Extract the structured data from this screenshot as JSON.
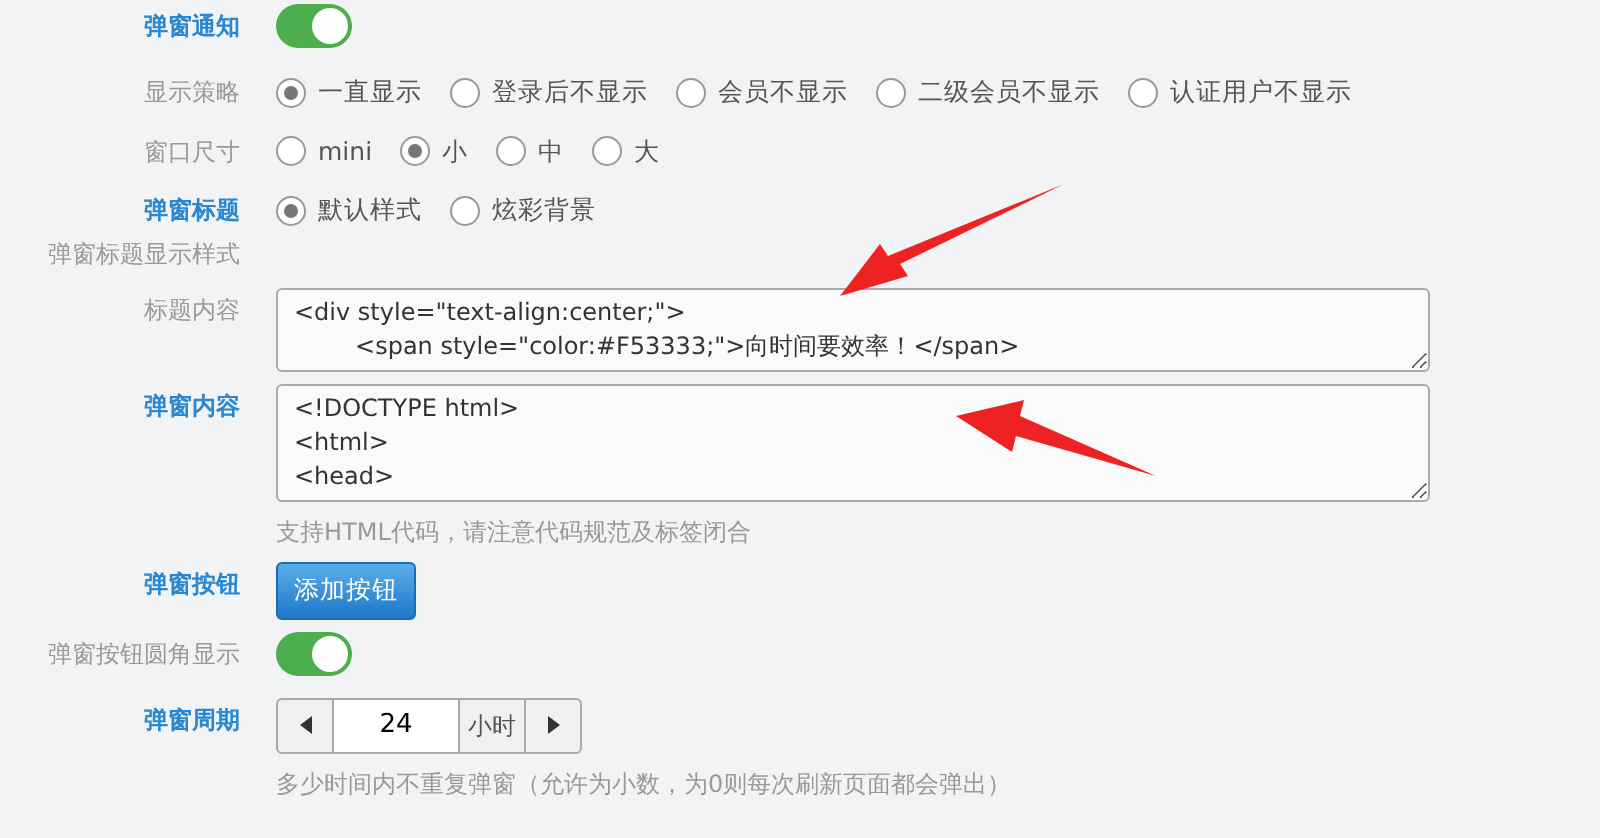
{
  "rows": [
    {
      "kind": "toggle",
      "label": "弹窗通知",
      "highlighted": true,
      "on": true
    },
    {
      "kind": "radio",
      "label": "显示策略",
      "highlighted": false,
      "options": [
        {
          "label": "一直显示",
          "selected": true
        },
        {
          "label": "登录后不显示",
          "selected": false
        },
        {
          "label": "会员不显示",
          "selected": false
        },
        {
          "label": "二级会员不显示",
          "selected": false
        },
        {
          "label": "认证用户不显示",
          "selected": false
        }
      ]
    },
    {
      "kind": "radio",
      "label": "窗口尺寸",
      "highlighted": false,
      "options": [
        {
          "label": "mini",
          "selected": false
        },
        {
          "label": "小",
          "selected": true
        },
        {
          "label": "中",
          "selected": false
        },
        {
          "label": "大",
          "selected": false
        }
      ]
    },
    {
      "kind": "radio",
      "label": "弹窗标题",
      "sublabel": "弹窗标题显示样式",
      "highlighted": true,
      "options": [
        {
          "label": "默认样式",
          "selected": true
        },
        {
          "label": "炫彩背景",
          "selected": false
        }
      ]
    },
    {
      "kind": "textarea",
      "label": "标题内容",
      "highlighted": false,
      "value": "<div style=\"text-align:center;\">\n        <span style=\"color:#F53333;\">向时间要效率！</span>"
    },
    {
      "kind": "textarea",
      "label": "弹窗内容",
      "highlighted": true,
      "value": "<!DOCTYPE html>\n<html>\n<head>",
      "hint": "支持HTML代码，请注意代码规范及标签闭合"
    },
    {
      "kind": "button",
      "label": "弹窗按钮",
      "highlighted": true,
      "button": "添加按钮"
    },
    {
      "kind": "toggle",
      "label": "弹窗按钮圆角显示",
      "highlighted": false,
      "on": true
    },
    {
      "kind": "stepper",
      "label": "弹窗周期",
      "highlighted": true,
      "value": "24",
      "unit": "小时",
      "hint": "多少时间内不重复弹窗（允许为小数，为0则每次刷新页面都会弹出）"
    }
  ]
}
